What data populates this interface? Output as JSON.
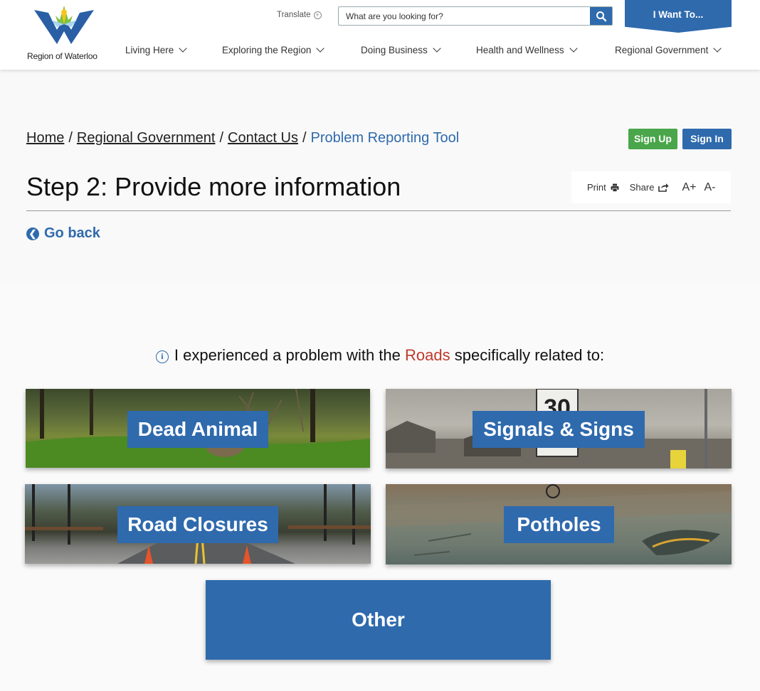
{
  "header": {
    "logo_text": "Region of Waterloo",
    "translate_label": "Translate",
    "search_placeholder": "What are you looking for?",
    "iwant_label": "I Want To...",
    "nav": [
      {
        "label": "Living Here"
      },
      {
        "label": "Exploring the Region"
      },
      {
        "label": "Doing Business"
      },
      {
        "label": "Health and Wellness"
      },
      {
        "label": "Regional Government"
      }
    ]
  },
  "breadcrumb": {
    "items": [
      "Home",
      "Regional Government",
      "Contact Us"
    ],
    "separator": "/",
    "current": "Problem Reporting Tool"
  },
  "account": {
    "signup": "Sign Up",
    "signin": "Sign In"
  },
  "page": {
    "title": "Step 2: Provide more information",
    "go_back": "Go back"
  },
  "tools": {
    "print": "Print",
    "share": "Share",
    "increase": "A+",
    "decrease": "A-"
  },
  "question": {
    "prefix": "I experienced a problem with the",
    "highlight": "Roads",
    "suffix": "specifically related to:"
  },
  "tiles": [
    {
      "label": "Dead Animal"
    },
    {
      "label": "Signals & Signs",
      "sign_number": "30"
    },
    {
      "label": "Road Closures"
    },
    {
      "label": "Potholes"
    },
    {
      "label": "Other"
    }
  ],
  "colors": {
    "brand_blue": "#2f6aad",
    "green": "#4aa64a",
    "highlight_red": "#c0392b"
  }
}
